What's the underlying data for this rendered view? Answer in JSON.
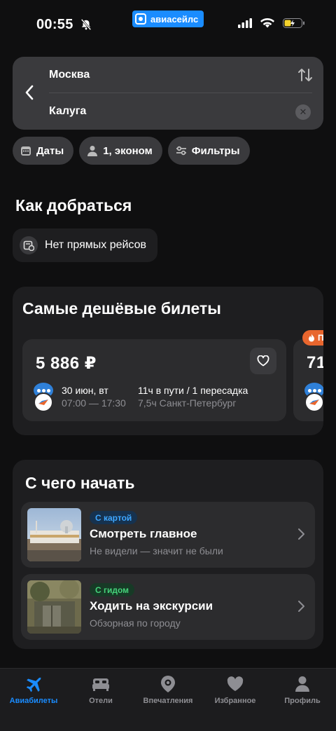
{
  "status_bar": {
    "time": "00:55",
    "brand": "авиасейлс"
  },
  "search": {
    "from": "Москва",
    "to": "Калуга"
  },
  "chips": [
    {
      "label": "Даты",
      "icon": "calendar-icon"
    },
    {
      "label": "1, эконом",
      "icon": "person-icon"
    },
    {
      "label": "Фильтры",
      "icon": "filters-icon"
    }
  ],
  "how_to_get": {
    "title": "Как добраться",
    "direct_flights": "Нет прямых рейсов"
  },
  "cheapest": {
    "title": "Самые дешёвые билеты",
    "ticket": {
      "price": "5 886 ₽",
      "date": "30 июн, вт",
      "time": "07:00 — 17:30",
      "duration": "11ч в пути / 1 пересадка",
      "transfer": "7,5ч Санкт-Петербург"
    },
    "next_ticket_price_partial": "71",
    "next_badge": "П"
  },
  "start": {
    "title": "С чего начать",
    "items": [
      {
        "tag": "С картой",
        "title": "Смотреть главное",
        "subtitle": "Не видели — значит не были"
      },
      {
        "tag": "С гидом",
        "title": "Ходить на экскурсии",
        "subtitle": "Обзорная по городу"
      }
    ]
  },
  "tabs": [
    {
      "label": "Авиабилеты",
      "icon": "plane-icon",
      "active": true
    },
    {
      "label": "Отели",
      "icon": "bed-icon",
      "active": false
    },
    {
      "label": "Впечатления",
      "icon": "location-pin-icon",
      "active": false
    },
    {
      "label": "Избранное",
      "icon": "heart-icon",
      "active": false
    },
    {
      "label": "Профиль",
      "icon": "profile-icon",
      "active": false
    }
  ],
  "colors": {
    "accent": "#1a8cff",
    "background": "#0f0f10",
    "card": "#1e1e20",
    "hot": "#e8662e"
  }
}
